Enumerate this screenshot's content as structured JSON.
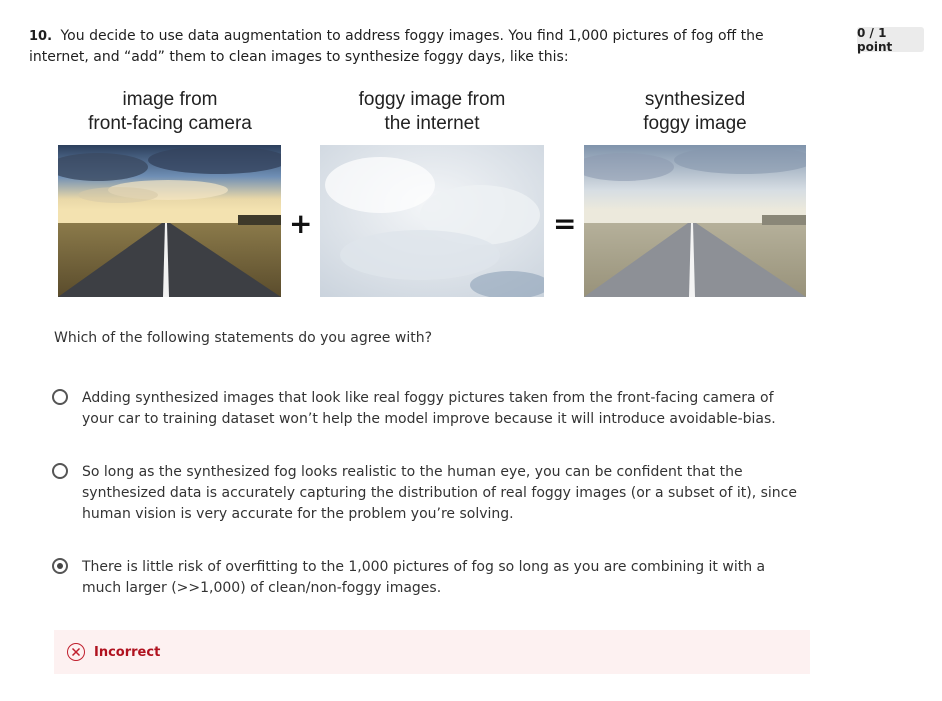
{
  "question": {
    "number": "10.",
    "text": "You decide to use data augmentation to address foggy images. You find 1,000 pictures of fog off the internet, and “add” them to clean images to synthesize foggy days, like this:"
  },
  "points": "0 / 1 point",
  "figure": {
    "captions": {
      "camera": "image from\nfront-facing camera",
      "fog": "foggy image from\nthe internet",
      "synthesized": "synthesized\nfoggy image"
    },
    "plus": "+",
    "equals": "="
  },
  "prompt": "Which of the following statements do you agree with?",
  "options": [
    {
      "text": "Adding synthesized images that look like real foggy pictures taken from the front-facing camera of your car to training dataset won’t help the model improve because it will introduce avoidable-bias.",
      "selected": false
    },
    {
      "text": "So long as the synthesized fog looks realistic to the human eye, you can be confident that the synthesized data is accurately capturing the distribution of real foggy images (or a subset of it), since human vision is very accurate for the problem you’re solving.",
      "selected": false
    },
    {
      "text": "There is little risk of overfitting to the 1,000 pictures of fog so long as you are combining it with a much larger (>>1,000) of clean/non-foggy images.",
      "selected": true
    }
  ],
  "feedback": {
    "status": "Incorrect",
    "color": "#b0121f"
  }
}
